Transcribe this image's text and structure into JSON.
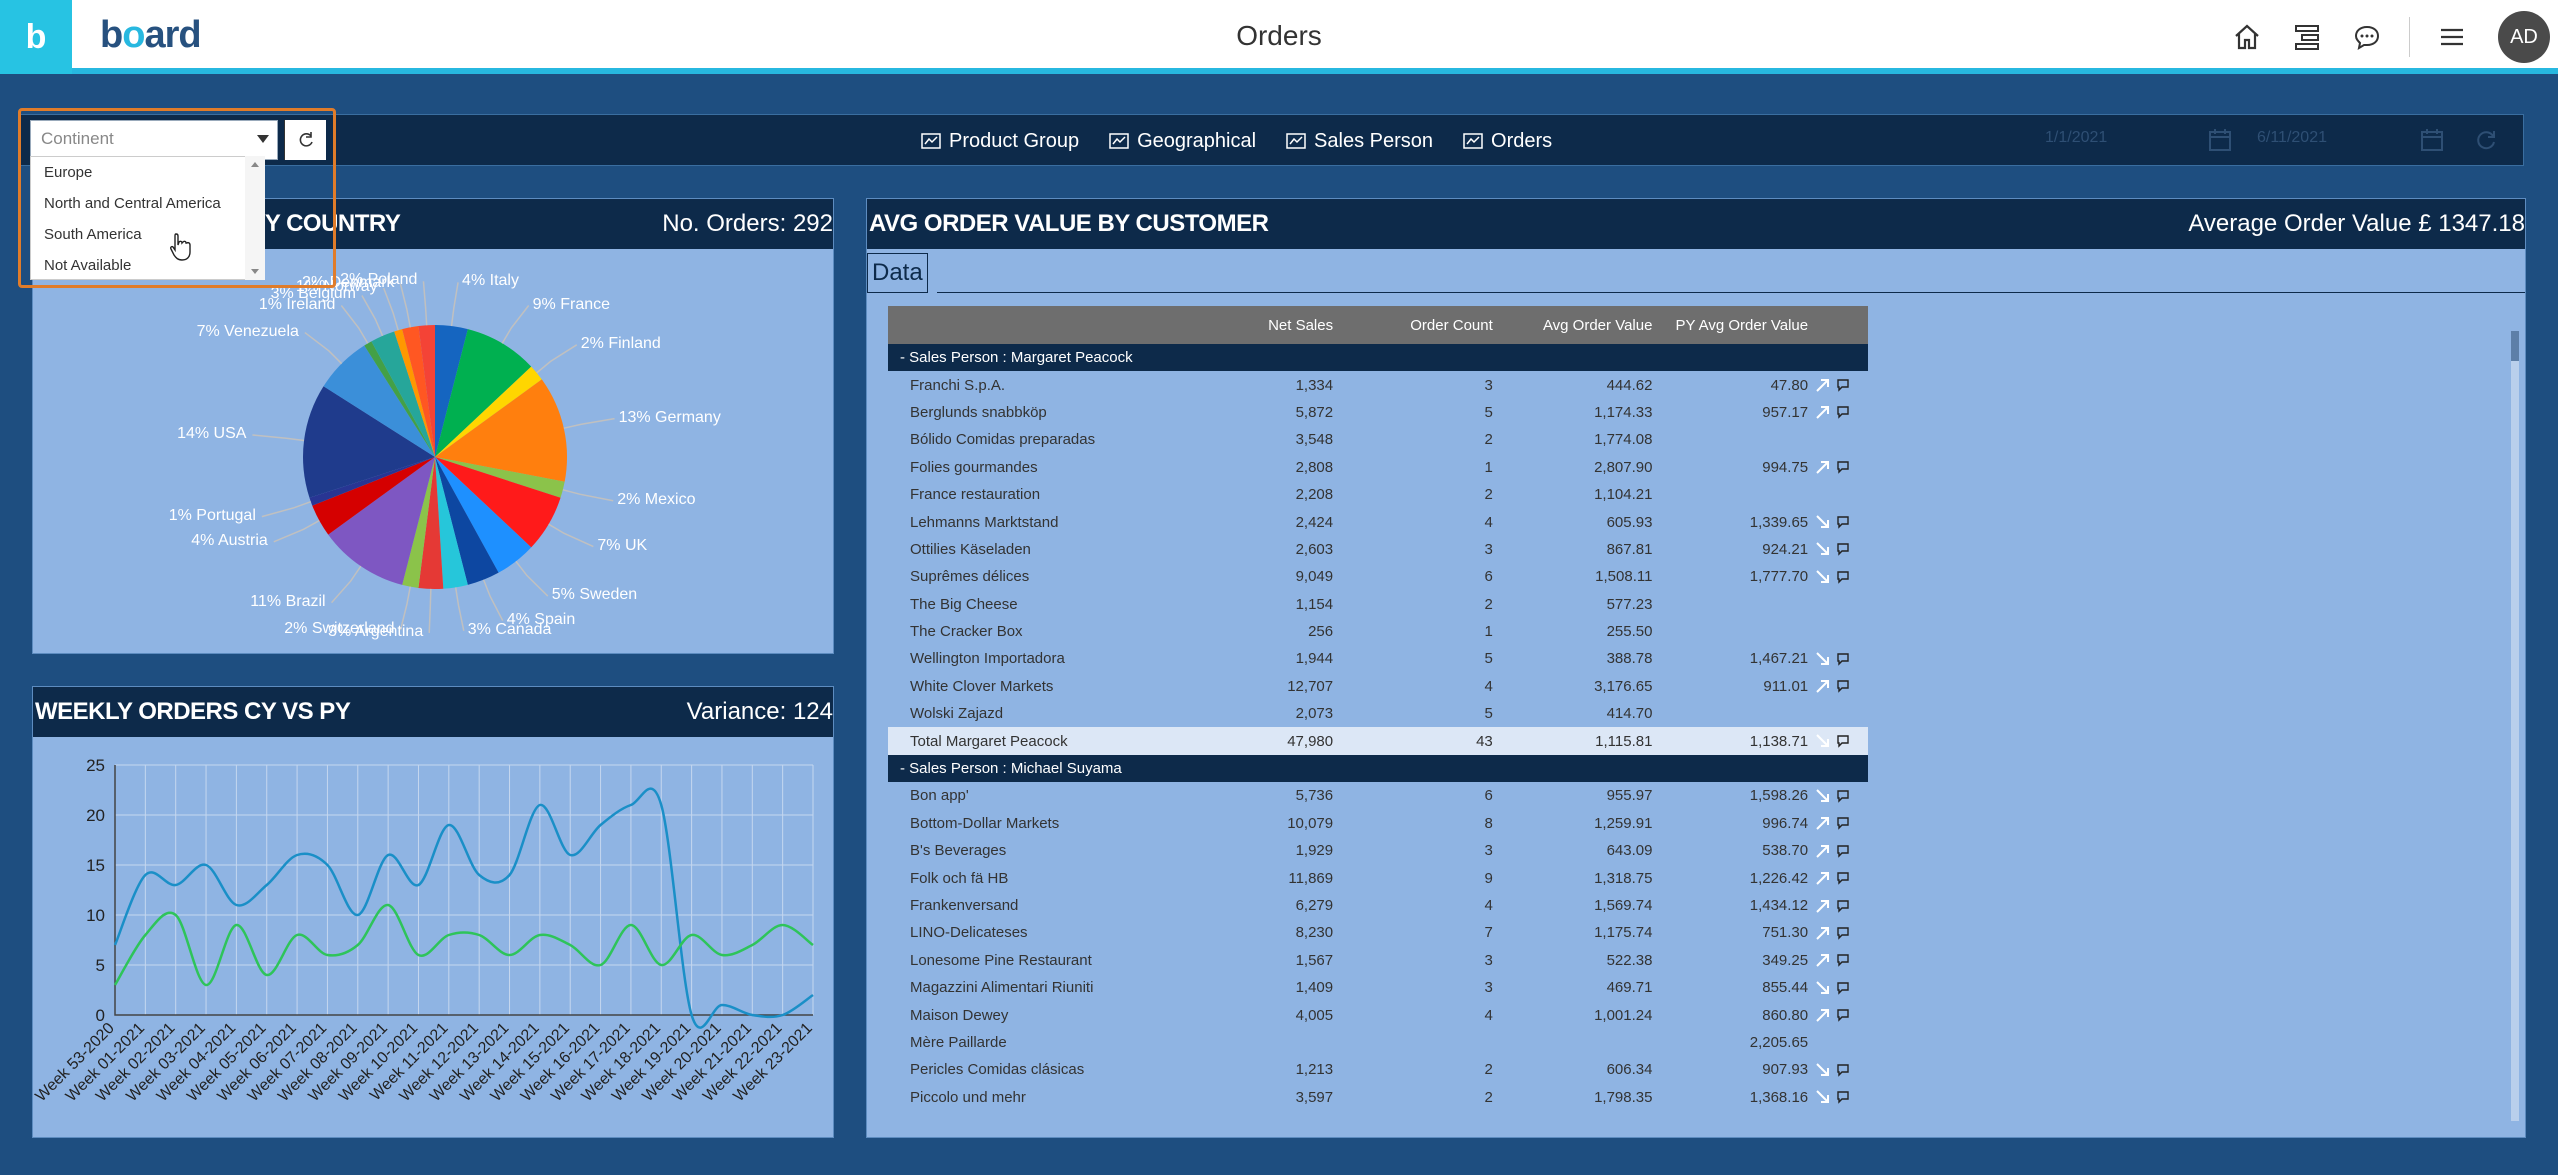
{
  "app": {
    "logo_letter": "b",
    "logo_word_start": "b",
    "logo_word_o": "o",
    "logo_word_end": "ard",
    "title": "Orders",
    "avatar_initials": "AD",
    "icons": [
      "home-icon",
      "hierarchy-icon",
      "chat-icon",
      "menu-icon"
    ]
  },
  "filter": {
    "continent_placeholder": "Continent",
    "continent_options": [
      "Europe",
      "North and Central America",
      "South America",
      "Not Available"
    ],
    "nav": [
      {
        "label": "Product Group",
        "icon": "screen-icon"
      },
      {
        "label": "Geographical",
        "icon": "screen-icon"
      },
      {
        "label": "Sales Person",
        "icon": "screen-icon"
      },
      {
        "label": "Orders",
        "icon": "screen-icon"
      }
    ],
    "date_from": "1/1/2021",
    "date_to": "6/11/2021"
  },
  "pie_panel": {
    "title": "N BY COUNTRY",
    "kpi": "No. Orders: 292",
    "colors": {
      "germany": "#ff7f0e",
      "usa": "#1f3b8c",
      "mexico": "#8bc34a",
      "uk": "#e41a1c",
      "venezuela": "#3b8fd9",
      "brazil": "#7e57c2",
      "finland": "#f4e542"
    }
  },
  "chart_data": [
    {
      "type": "pie",
      "title": "",
      "slices": [
        {
          "label": "Italy",
          "value": 4
        },
        {
          "label": "France",
          "value": 9
        },
        {
          "label": "Finland",
          "value": 2
        },
        {
          "label": "Germany",
          "value": 13
        },
        {
          "label": "Mexico",
          "value": 2
        },
        {
          "label": "UK",
          "value": 7
        },
        {
          "label": "Sweden",
          "value": 5
        },
        {
          "label": "Spain",
          "value": 4
        },
        {
          "label": "Canada",
          "value": 3
        },
        {
          "label": "Argentina",
          "value": 3
        },
        {
          "label": "Switzerland",
          "value": 2
        },
        {
          "label": "Brazil",
          "value": 11
        },
        {
          "label": "Austria",
          "value": 4
        },
        {
          "label": "Portugal",
          "value": 1
        },
        {
          "label": "USA",
          "value": 14
        },
        {
          "label": "Venezuela",
          "value": 7
        },
        {
          "label": "Ireland",
          "value": 1
        },
        {
          "label": "Belgium",
          "value": 3
        },
        {
          "label": "Norway",
          "value": 1
        },
        {
          "label": "Denmark",
          "value": 2
        },
        {
          "label": "Poland",
          "value": 2
        }
      ],
      "slice_labels": [
        "4% Italy",
        "9% France",
        "2% Finland",
        "13% Germany",
        "2% Mexico",
        "7% UK",
        "5% Sweden",
        "4% Spain",
        "3% Canada",
        "3% Argentina",
        "2% Switzerland",
        "11% Brazil",
        "4% Austria",
        "1% Portugal",
        "14% USA",
        "7% Venezuela",
        "1% Ireland",
        "3% Belgium",
        "1% Norway",
        "2% Denmark",
        "2% Poland"
      ]
    },
    {
      "type": "line",
      "title": "",
      "categories": [
        "Week 53-2020",
        "Week 01-2021",
        "Week 02-2021",
        "Week 03-2021",
        "Week 04-2021",
        "Week 05-2021",
        "Week 06-2021",
        "Week 07-2021",
        "Week 08-2021",
        "Week 09-2021",
        "Week 10-2021",
        "Week 11-2021",
        "Week 12-2021",
        "Week 13-2021",
        "Week 14-2021",
        "Week 15-2021",
        "Week 16-2021",
        "Week 17-2021",
        "Week 18-2021",
        "Week 19-2021",
        "Week 20-2021",
        "Week 21-2021",
        "Week 22-2021",
        "Week 23-2021"
      ],
      "series": [
        {
          "values": [
            7,
            14,
            13,
            15,
            11,
            13,
            16,
            15,
            10,
            16,
            13,
            19,
            14,
            14,
            21,
            16,
            19,
            21,
            21,
            0,
            1,
            0,
            0,
            2
          ]
        },
        {
          "values": [
            3,
            8,
            10,
            3,
            9,
            4,
            8,
            6,
            7,
            11,
            6,
            8,
            8,
            6,
            8,
            7,
            5,
            9,
            5,
            8,
            6,
            7,
            9,
            7
          ]
        }
      ],
      "ylim": [
        0,
        25
      ],
      "yticks": [
        "0",
        "5",
        "10",
        "15",
        "20",
        "25"
      ],
      "grid": true,
      "colors": [
        "#1a8fc7",
        "#2ec45a"
      ]
    }
  ],
  "weekly_panel": {
    "title": "WEEKLY ORDERS CY VS PY",
    "kpi": "Variance: 124"
  },
  "avg_panel": {
    "title": "AVG ORDER VALUE BY CUSTOMER",
    "kpi": "Average Order Value £ 1347.18",
    "data_tab": "Data",
    "columns": [
      "Net Sales",
      "Order Count",
      "Avg Order Value",
      "PY Avg Order Value"
    ],
    "groups": [
      {
        "header": "-  Sales Person : Margaret Peacock",
        "rows": [
          {
            "name": "Franchi S.p.A.",
            "net": "1,334",
            "count": "3",
            "avg": "444.62",
            "py": "47.80",
            "trend": "up"
          },
          {
            "name": "Berglunds snabbköp",
            "net": "5,872",
            "count": "5",
            "avg": "1,174.33",
            "py": "957.17",
            "trend": "up"
          },
          {
            "name": "Bólido Comidas preparadas",
            "net": "3,548",
            "count": "2",
            "avg": "1,774.08",
            "py": "",
            "trend": ""
          },
          {
            "name": "Folies gourmandes",
            "net": "2,808",
            "count": "1",
            "avg": "2,807.90",
            "py": "994.75",
            "trend": "up"
          },
          {
            "name": "France restauration",
            "net": "2,208",
            "count": "2",
            "avg": "1,104.21",
            "py": "",
            "trend": ""
          },
          {
            "name": "Lehmanns Marktstand",
            "net": "2,424",
            "count": "4",
            "avg": "605.93",
            "py": "1,339.65",
            "trend": "down"
          },
          {
            "name": "Ottilies Käseladen",
            "net": "2,603",
            "count": "3",
            "avg": "867.81",
            "py": "924.21",
            "trend": "down"
          },
          {
            "name": "Suprêmes délices",
            "net": "9,049",
            "count": "6",
            "avg": "1,508.11",
            "py": "1,777.70",
            "trend": "down"
          },
          {
            "name": "The Big Cheese",
            "net": "1,154",
            "count": "2",
            "avg": "577.23",
            "py": "",
            "trend": ""
          },
          {
            "name": "The Cracker Box",
            "net": "256",
            "count": "1",
            "avg": "255.50",
            "py": "",
            "trend": ""
          },
          {
            "name": "Wellington Importadora",
            "net": "1,944",
            "count": "5",
            "avg": "388.78",
            "py": "1,467.21",
            "trend": "down"
          },
          {
            "name": "White Clover Markets",
            "net": "12,707",
            "count": "4",
            "avg": "3,176.65",
            "py": "911.01",
            "trend": "up"
          },
          {
            "name": "Wolski  Zajazd",
            "net": "2,073",
            "count": "5",
            "avg": "414.70",
            "py": "",
            "trend": ""
          }
        ],
        "total": {
          "name": "Total Margaret Peacock",
          "net": "47,980",
          "count": "43",
          "avg": "1,115.81",
          "py": "1,138.71",
          "trend": "down"
        }
      },
      {
        "header": "-  Sales Person : Michael Suyama",
        "rows": [
          {
            "name": "Bon app'",
            "net": "5,736",
            "count": "6",
            "avg": "955.97",
            "py": "1,598.26",
            "trend": "down"
          },
          {
            "name": "Bottom-Dollar Markets",
            "net": "10,079",
            "count": "8",
            "avg": "1,259.91",
            "py": "996.74",
            "trend": "up"
          },
          {
            "name": "B's Beverages",
            "net": "1,929",
            "count": "3",
            "avg": "643.09",
            "py": "538.70",
            "trend": "up"
          },
          {
            "name": "Folk och fä HB",
            "net": "11,869",
            "count": "9",
            "avg": "1,318.75",
            "py": "1,226.42",
            "trend": "up"
          },
          {
            "name": "Frankenversand",
            "net": "6,279",
            "count": "4",
            "avg": "1,569.74",
            "py": "1,434.12",
            "trend": "up"
          },
          {
            "name": "LINO-Delicateses",
            "net": "8,230",
            "count": "7",
            "avg": "1,175.74",
            "py": "751.30",
            "trend": "up"
          },
          {
            "name": "Lonesome Pine Restaurant",
            "net": "1,567",
            "count": "3",
            "avg": "522.38",
            "py": "349.25",
            "trend": "up"
          },
          {
            "name": "Magazzini Alimentari Riuniti",
            "net": "1,409",
            "count": "3",
            "avg": "469.71",
            "py": "855.44",
            "trend": "down"
          },
          {
            "name": "Maison Dewey",
            "net": "4,005",
            "count": "4",
            "avg": "1,001.24",
            "py": "860.80",
            "trend": "up"
          },
          {
            "name": "Mère Paillarde",
            "net": "",
            "count": "",
            "avg": "",
            "py": "2,205.65",
            "trend": ""
          },
          {
            "name": "Pericles Comidas clásicas",
            "net": "1,213",
            "count": "2",
            "avg": "606.34",
            "py": "907.93",
            "trend": "down"
          },
          {
            "name": "Piccolo und mehr",
            "net": "3,597",
            "count": "2",
            "avg": "1,798.35",
            "py": "1,368.16",
            "trend": "down"
          }
        ]
      }
    ]
  }
}
